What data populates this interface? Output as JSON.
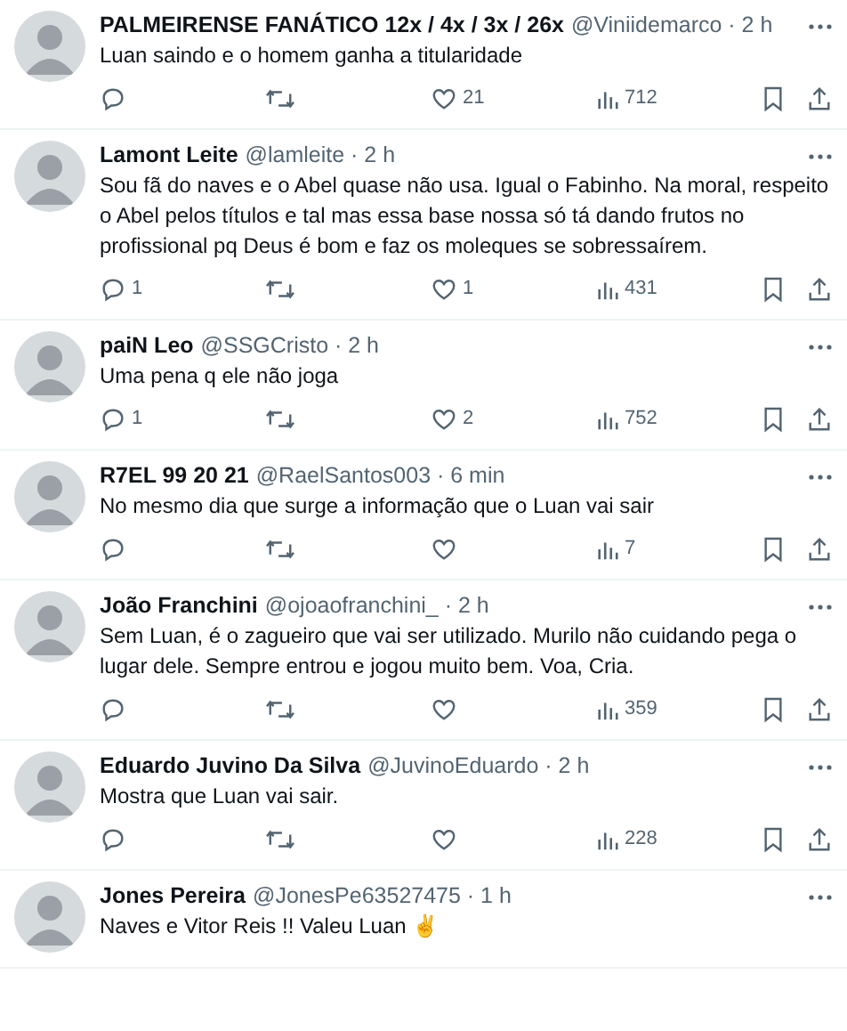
{
  "replies": [
    {
      "name": "PALMEIRENSE FANÁTICO 12x / 4x / 3x / 26x",
      "byline": "@Viniidemarco · 2 h",
      "text": "Luan saindo e o homem ganha a titularidade",
      "stats": {
        "likes": "21",
        "views": "712"
      }
    },
    {
      "name": "Lamont Leite",
      "byline": "@lamleite · 2 h",
      "text": "Sou fã do naves e o Abel quase não usa. Igual o Fabinho. Na moral, respeito o Abel pelos títulos e tal mas essa base nossa só tá dando frutos no profissional pq Deus é bom e faz os moleques se sobressaírem.",
      "stats": {
        "replies": "1",
        "likes": "1",
        "views": "431"
      }
    },
    {
      "name": "paiN Leo",
      "byline": "@SSGCristo · 2 h",
      "text": "Uma pena q ele não joga",
      "stats": {
        "replies": "1",
        "likes": "2",
        "views": "752"
      }
    },
    {
      "name": "R7EL 99 20 21",
      "byline": "@RaelSantos003 · 6 min",
      "text": "No mesmo dia que surge a informação que o Luan vai sair",
      "stats": {
        "views": "7"
      }
    },
    {
      "name": "João Franchini",
      "byline": "@ojoaofranchini_ · 2 h",
      "text": "Sem Luan, é o zagueiro que vai ser utilizado. Murilo não cuidando pega o lugar dele. Sempre entrou e jogou muito bem. Voa, Cria.",
      "stats": {
        "views": "359"
      }
    },
    {
      "name": "Eduardo Juvino Da Silva",
      "byline": "@JuvinoEduardo · 2 h",
      "text": "Mostra que Luan vai sair.",
      "stats": {
        "views": "228"
      }
    },
    {
      "name": "Jones Pereira",
      "byline": "@JonesPe63527475 · 1 h",
      "text": "Naves e Vitor Reis !! Valeu Luan ✌"
    }
  ]
}
